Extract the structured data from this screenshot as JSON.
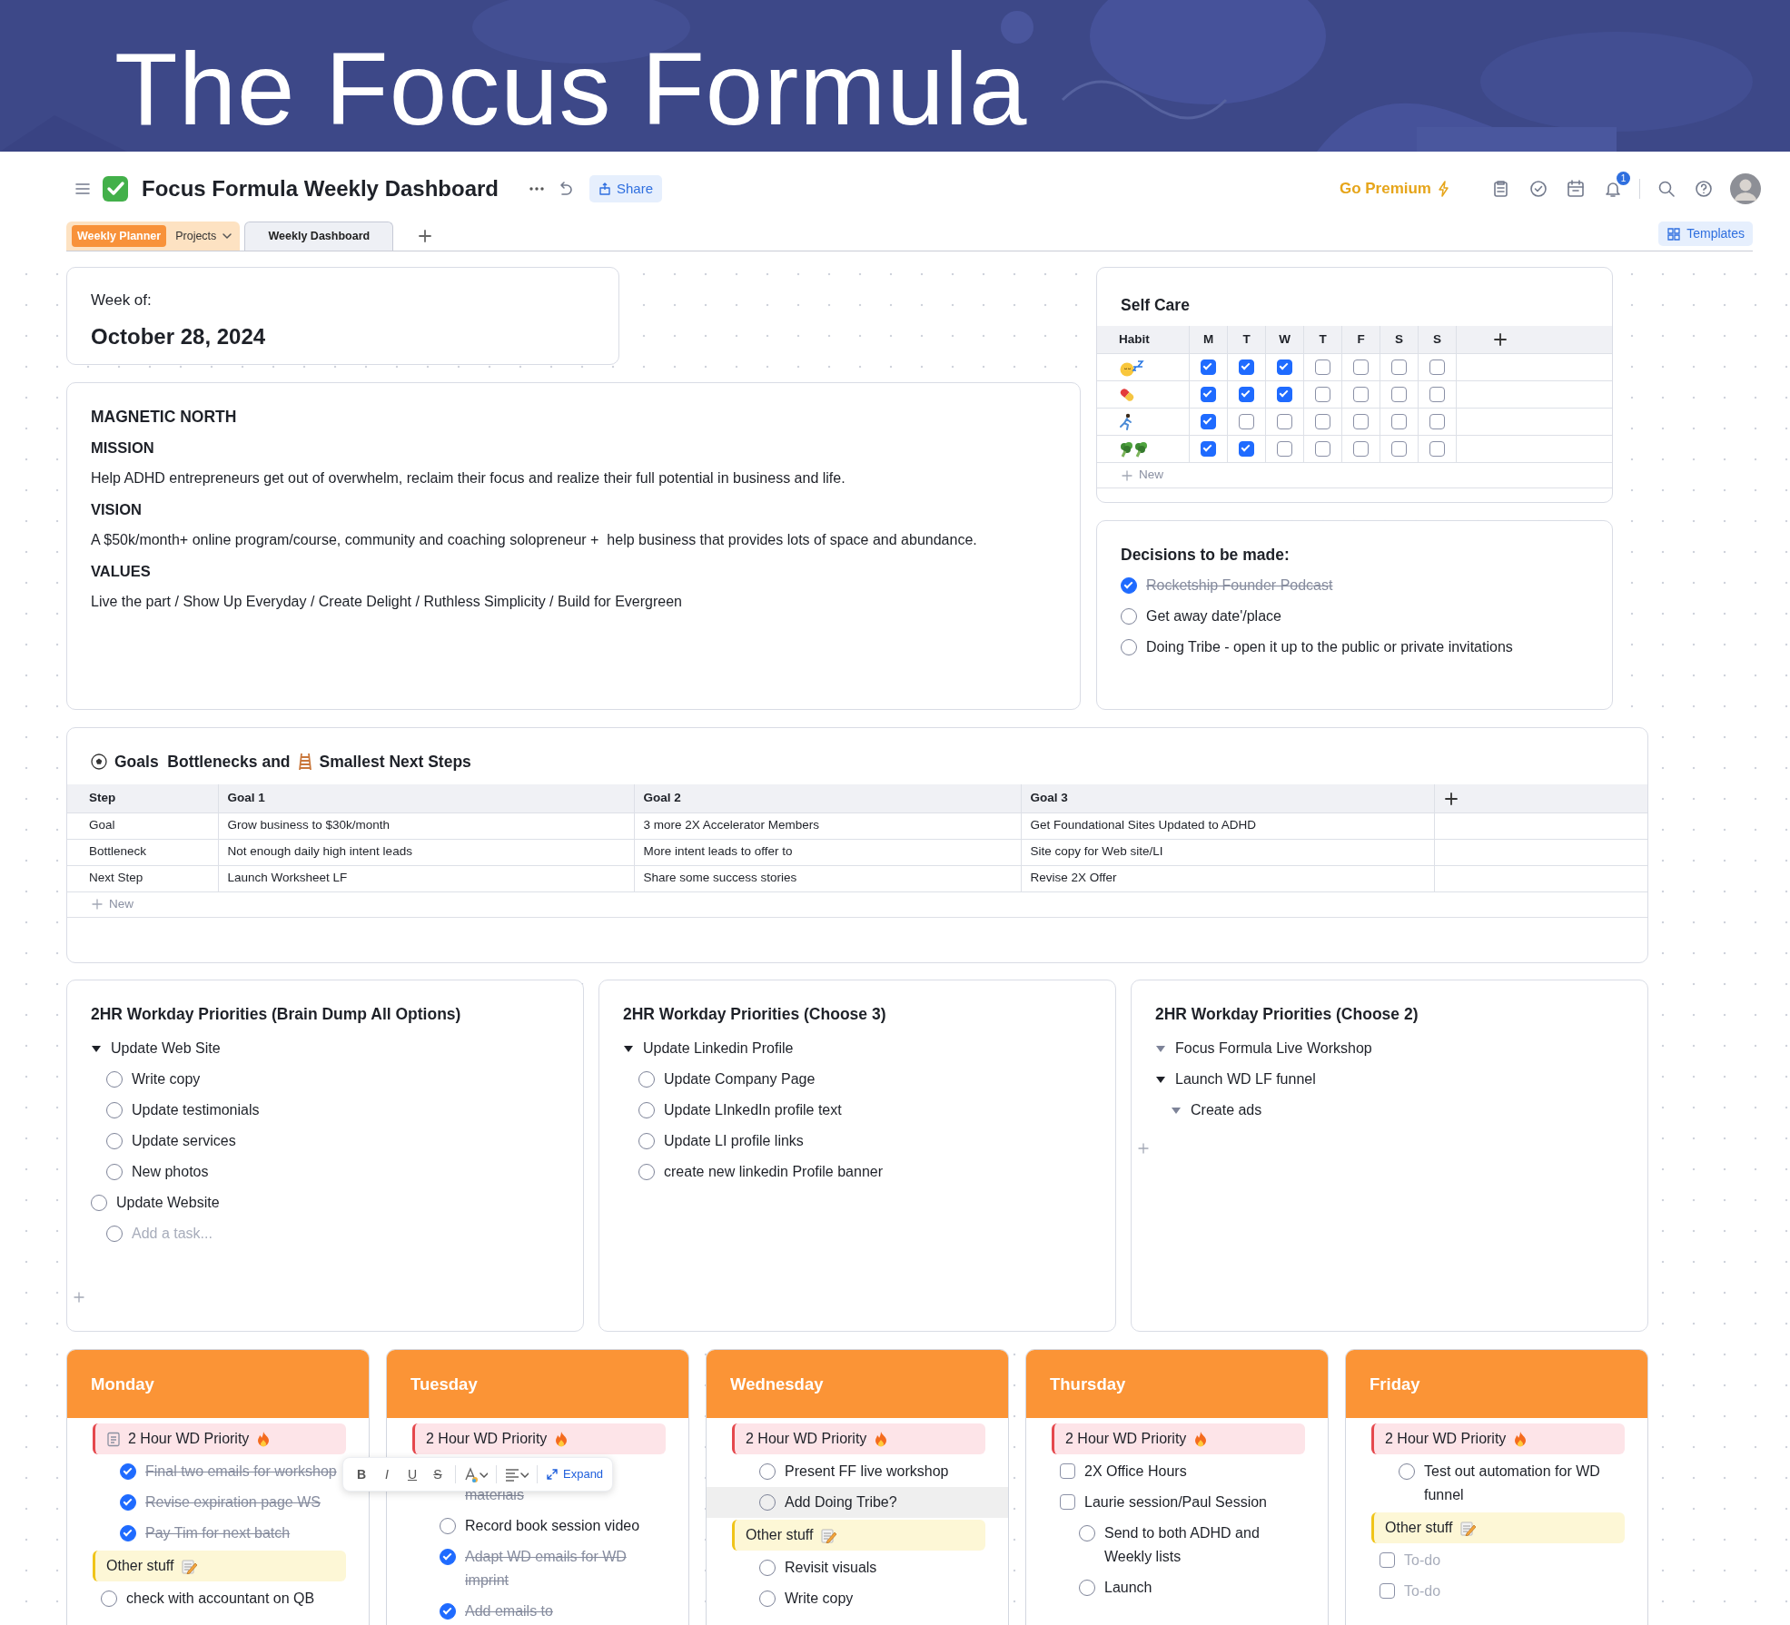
{
  "banner": {
    "title": "The Focus Formula"
  },
  "header": {
    "title": "Focus Formula Weekly Dashboard",
    "share": "Share",
    "premium": "Go Premium",
    "notifications": "1"
  },
  "tabs": [
    {
      "kind": "group",
      "label": "Weekly Planner",
      "dropdown": "Projects",
      "selected": false
    },
    {
      "kind": "page",
      "label": "Weekly Dashboard",
      "selected": true
    }
  ],
  "templates": "Templates",
  "week": {
    "label": "Week of:",
    "date": "October 28, 2024"
  },
  "magnetic": {
    "title": "MAGNETIC NORTH",
    "sections": [
      {
        "heading": "MISSION",
        "text": "Help ADHD entrepreneurs get out of overwhelm, reclaim their focus and realize their full potential in business and life."
      },
      {
        "heading": "VISION",
        "text": "A $50k/month+ online program/course, community and coaching solopreneur +  help business that provides lots of space and abundance."
      },
      {
        "heading": "VALUES",
        "text": "Live the part / Show Up Everyday / Create Delight / Ruthless Simplicity / Build for Evergreen"
      }
    ]
  },
  "self_care": {
    "title": "Self Care",
    "columns": [
      "Habit",
      "M",
      "T",
      "W",
      "T",
      "F",
      "S",
      "S"
    ],
    "habits": [
      {
        "kind": "sleep",
        "checks": [
          true,
          true,
          true,
          false,
          false,
          false,
          false
        ]
      },
      {
        "kind": "pill",
        "checks": [
          true,
          true,
          true,
          false,
          false,
          false,
          false
        ]
      },
      {
        "kind": "run",
        "checks": [
          true,
          false,
          false,
          false,
          false,
          false,
          false
        ]
      },
      {
        "kind": "broccoli",
        "checks": [
          true,
          true,
          false,
          false,
          false,
          false,
          false
        ]
      }
    ],
    "new": "New"
  },
  "decisions": {
    "title": "Decisions to be made:",
    "items": [
      {
        "text": "Rocketship Founder Podcast",
        "done": true
      },
      {
        "text": "Get away date'/place",
        "done": false
      },
      {
        "text": "Doing Tribe - open it up to the public or private invitations",
        "done": false
      }
    ]
  },
  "goals": {
    "title_start": "Goals  Bottlenecks and",
    "title_end": "Smallest Next Steps",
    "columns": [
      "Step",
      "Goal 1",
      "Goal 2",
      "Goal 3"
    ],
    "rows": [
      [
        "Goal",
        "Grow business to $30k/month",
        "3 more 2X Accelerator Members",
        "Get Foundational Sites Updated to ADHD"
      ],
      [
        "Bottleneck",
        "Not enough daily high intent leads",
        "More intent leads to offer to",
        "Site copy for Web site/LI"
      ],
      [
        "Next Step",
        "Launch Worksheet LF",
        "Share some success stories",
        "Revise 2X Offer"
      ]
    ],
    "new": "New"
  },
  "priorities": [
    {
      "title": "2HR Workday Priorities (Brain Dump All Options)",
      "add_button": true,
      "items": [
        {
          "kind": "toggle",
          "text": "Update Web Site",
          "children": [
            {
              "kind": "task",
              "text": "Write copy",
              "done": false
            },
            {
              "kind": "task",
              "text": "Update testimonials",
              "done": false
            },
            {
              "kind": "task",
              "text": "Update services",
              "done": false
            },
            {
              "kind": "task",
              "text": "New photos",
              "done": false
            }
          ]
        },
        {
          "kind": "task",
          "text": "Update Website",
          "done": false,
          "children": [
            {
              "kind": "placeholder",
              "text": "Add a task...",
              "done": false
            }
          ]
        }
      ]
    },
    {
      "title": "2HR Workday Priorities (Choose 3)",
      "add_button": false,
      "items": [
        {
          "kind": "toggle",
          "text": "Update Linkedin Profile",
          "children": [
            {
              "kind": "task",
              "text": "Update Company Page",
              "done": false
            },
            {
              "kind": "task",
              "text": "Update LInkedIn profile text",
              "done": false
            },
            {
              "kind": "task",
              "text": "Update LI profile links",
              "done": false
            },
            {
              "kind": "task",
              "text": "create new linkedin Profile banner",
              "done": false
            }
          ]
        }
      ]
    },
    {
      "title": "2HR Workday Priorities (Choose 2)",
      "add_button": true,
      "items": [
        {
          "kind": "toggle",
          "text": "Focus Formula Live Workshop"
        },
        {
          "kind": "toggle",
          "text": "Launch WD LF funnel",
          "children": [
            {
              "kind": "toggle",
              "text": "Create ads"
            }
          ]
        }
      ]
    }
  ],
  "days": [
    {
      "name": "Monday",
      "items": [
        {
          "kind": "priority",
          "text": "2 Hour WD Priority",
          "has_page": true,
          "children": [
            {
              "kind": "task",
              "text": "Final two emails for workshop",
              "done": true
            },
            {
              "kind": "task",
              "text": "Revise expiration page WS",
              "done": true
            },
            {
              "kind": "task",
              "text": "Pay Tim for next batch",
              "done": true
            }
          ]
        },
        {
          "kind": "other",
          "text": "Other stuff"
        },
        {
          "kind": "task",
          "text": "check with accountant on QB",
          "done": false
        }
      ]
    },
    {
      "name": "Tuesday",
      "items": [
        {
          "kind": "priority",
          "text": "2 Hour WD Priority",
          "has_page": false,
          "children": [
            {
              "kind": "partial",
              "text": "materials",
              "done": true
            },
            {
              "kind": "task",
              "text": "Record book session video",
              "done": false
            },
            {
              "kind": "task",
              "text": "Adapt WD emails for WD imprint",
              "done": true
            },
            {
              "kind": "task",
              "text": "Add emails to",
              "done": true
            }
          ]
        }
      ]
    },
    {
      "name": "Wednesday",
      "items": [
        {
          "kind": "priority",
          "text": "2 Hour WD Priority",
          "has_page": false,
          "children": [
            {
              "kind": "task",
              "text": "Present FF live workshop",
              "done": false
            },
            {
              "kind": "task",
              "text": "Add Doing Tribe?",
              "done": false,
              "highlighted": true
            }
          ]
        },
        {
          "kind": "other",
          "text": "Other stuff",
          "children": [
            {
              "kind": "task",
              "text": "Revisit visuals",
              "done": false
            },
            {
              "kind": "task",
              "text": "Write copy",
              "done": false
            }
          ]
        }
      ]
    },
    {
      "name": "Thursday",
      "items": [
        {
          "kind": "priority",
          "text": "2 Hour WD Priority",
          "has_page": false
        },
        {
          "kind": "todo",
          "text": "2X Office Hours",
          "done": false
        },
        {
          "kind": "todo",
          "text": "Laurie session/Paul Session",
          "done": false,
          "children": [
            {
              "kind": "task",
              "text": "Send to both ADHD and Weekly lists",
              "done": false
            },
            {
              "kind": "task",
              "text": "Launch",
              "done": false
            }
          ]
        }
      ]
    },
    {
      "name": "Friday",
      "items": [
        {
          "kind": "priority",
          "text": "2 Hour WD Priority",
          "has_page": false,
          "children": [
            {
              "kind": "task",
              "text": "Test out automation for WD funnel",
              "done": false
            }
          ]
        },
        {
          "kind": "other",
          "text": "Other stuff"
        },
        {
          "kind": "placeholder",
          "text": "To-do",
          "done": false
        },
        {
          "kind": "placeholder",
          "text": "To-do",
          "done": false
        }
      ]
    }
  ],
  "toolbar": {
    "format": [
      "B",
      "I",
      "U",
      "S"
    ],
    "expand": "Expand"
  }
}
